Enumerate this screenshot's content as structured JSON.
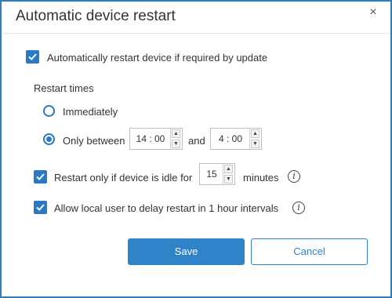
{
  "dialog": {
    "title": "Automatic device restart",
    "close_glyph": "×"
  },
  "options": {
    "auto_restart_label": "Automatically restart device if required by update",
    "auto_restart_checked": true,
    "restart_times_label": "Restart times",
    "immediately_label": "Immediately",
    "immediately_selected": false,
    "only_between_label": "Only between",
    "only_between_selected": true,
    "start_time": "14 : 00",
    "and_label": "and",
    "end_time": "4 : 00",
    "idle_label": "Restart only if device is idle for",
    "idle_checked": true,
    "idle_minutes": "15",
    "minutes_label": "minutes",
    "delay_label": "Allow local user to delay restart in 1 hour intervals",
    "delay_checked": true
  },
  "icons": {
    "info_glyph": "i",
    "up_glyph": "▲",
    "down_glyph": "▼"
  },
  "buttons": {
    "save_label": "Save",
    "cancel_label": "Cancel"
  },
  "colors": {
    "accent": "#2979c4",
    "border": "#2e7fc1",
    "primary_button": "#2e83c9"
  }
}
